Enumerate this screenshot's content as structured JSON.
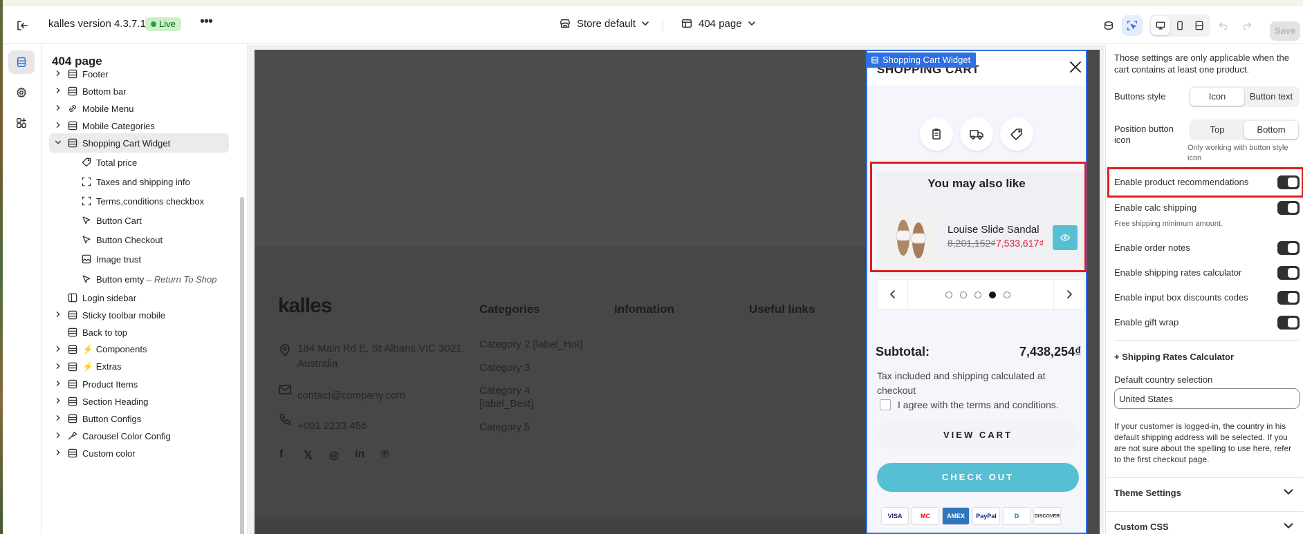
{
  "topbar": {
    "app_title": "kalles version 4.3.7.1",
    "status_badge": "Live",
    "more_label": "•••",
    "store_selector": "Store default",
    "page_selector": "404 page",
    "save_label": "Save"
  },
  "sidebar": {
    "title": "404 page",
    "items": [
      {
        "label": "Footer",
        "level": 0,
        "expandable": true,
        "icon": "section-icon"
      },
      {
        "label": "Bottom bar",
        "level": 0,
        "expandable": true,
        "icon": "section-icon"
      },
      {
        "label": "Mobile Menu",
        "level": 0,
        "expandable": true,
        "icon": "link-icon"
      },
      {
        "label": "Mobile Categories",
        "level": 0,
        "expandable": true,
        "icon": "section-icon"
      },
      {
        "label": "Shopping Cart Widget",
        "level": 0,
        "expandable": true,
        "expanded": true,
        "selected": true,
        "icon": "section-icon"
      },
      {
        "label": "Total price",
        "level": 1,
        "icon": "price-tag-icon"
      },
      {
        "label": "Taxes and shipping info",
        "level": 1,
        "icon": "dashed-box-icon"
      },
      {
        "label": "Terms,conditions checkbox",
        "level": 1,
        "icon": "dashed-box-icon"
      },
      {
        "label": "Button Cart",
        "level": 1,
        "icon": "cursor-icon"
      },
      {
        "label": "Button Checkout",
        "level": 1,
        "icon": "cursor-icon"
      },
      {
        "label": "Image trust",
        "level": 1,
        "icon": "image-icon"
      },
      {
        "label": "Button emty",
        "suffix": "Return To Shop",
        "level": 1,
        "icon": "cursor-icon"
      },
      {
        "label": "Login sidebar",
        "level": 0,
        "expandable": false,
        "icon": "sidebar-icon"
      },
      {
        "label": "Sticky toolbar mobile",
        "level": 0,
        "expandable": true,
        "icon": "section-icon"
      },
      {
        "label": "Back to top",
        "level": 0,
        "expandable": false,
        "icon": "section-icon"
      },
      {
        "label": "⚡ Components",
        "level": 0,
        "expandable": true,
        "icon": "section-icon"
      },
      {
        "label": "⚡ Extras",
        "level": 0,
        "expandable": true,
        "icon": "section-icon"
      },
      {
        "label": "Product Items",
        "level": 0,
        "expandable": true,
        "icon": "section-icon"
      },
      {
        "label": "Section Heading",
        "level": 0,
        "expandable": true,
        "icon": "section-icon"
      },
      {
        "label": "Button Configs",
        "level": 0,
        "expandable": true,
        "icon": "section-icon"
      },
      {
        "label": "Carousel Color Config",
        "level": 0,
        "expandable": true,
        "icon": "palette-icon"
      },
      {
        "label": "Custom color",
        "level": 0,
        "expandable": true,
        "icon": "section-icon"
      }
    ]
  },
  "preview": {
    "logo": "kalles",
    "address": [
      "184 Main Rd E, St Albans VIC 3021,",
      "Australia"
    ],
    "email": "contact@company.com",
    "phone": "+001 2233 456",
    "social": [
      "f",
      "𝕏",
      "◎",
      "in",
      "℗"
    ],
    "columns": [
      "Categories",
      "Infomation",
      "Useful links"
    ],
    "categories": [
      "Category 2 [label_Hot]",
      "Category 3",
      "Category 4",
      "[label_Best]",
      "Category 5"
    ]
  },
  "cart": {
    "widget_label": "Shopping Cart Widget",
    "title": "SHOPPING CART",
    "reco_title": "You may also like",
    "product_name": "Louise Slide Sandal",
    "old_price": "8,201,152₫",
    "new_price": "7,533,617₫",
    "subtotal_label": "Subtotal:",
    "subtotal_value": "7,438,254₫",
    "tax_text": "Tax included and shipping calculated at checkout",
    "terms_text": "I agree with the terms and conditions.",
    "view_cart": "VIEW CART",
    "checkout": "CHECK OUT",
    "payments": [
      "VISA",
      "MC",
      "AMEX",
      "PayPal",
      "D",
      "DISCOVER"
    ],
    "dots": 5,
    "active_dot": 4
  },
  "settings": {
    "note": "Those settings are only applicable when the cart contains at least one product.",
    "buttons_style": {
      "label": "Buttons style",
      "options": [
        "Icon",
        "Button text"
      ],
      "selected": "Icon"
    },
    "position_icon": {
      "label": "Position button icon",
      "options": [
        "Top",
        "Bottom"
      ],
      "selected": "Bottom",
      "help": "Only working with button style icon"
    },
    "toggles": [
      {
        "label": "Enable product recommendations",
        "on": true
      },
      {
        "label": "Enable calc shipping",
        "on": true,
        "help": "Free shipping minimum amount."
      },
      {
        "label": "Enable order notes",
        "on": true
      },
      {
        "label": "Enable shipping rates calculator",
        "on": true
      },
      {
        "label": "Enable input box discounts codes",
        "on": true
      },
      {
        "label": "Enable gift wrap",
        "on": true
      }
    ],
    "shipping_calc_heading": "+ Shipping Rates Calculator",
    "country_label": "Default country selection",
    "country_value": "United States",
    "country_help": "If your customer is logged-in, the country in his default shipping address will be selected. If you are not sure about the spelling to use here, refer to the first checkout page.",
    "sections": [
      "Theme Settings",
      "Custom CSS"
    ]
  }
}
